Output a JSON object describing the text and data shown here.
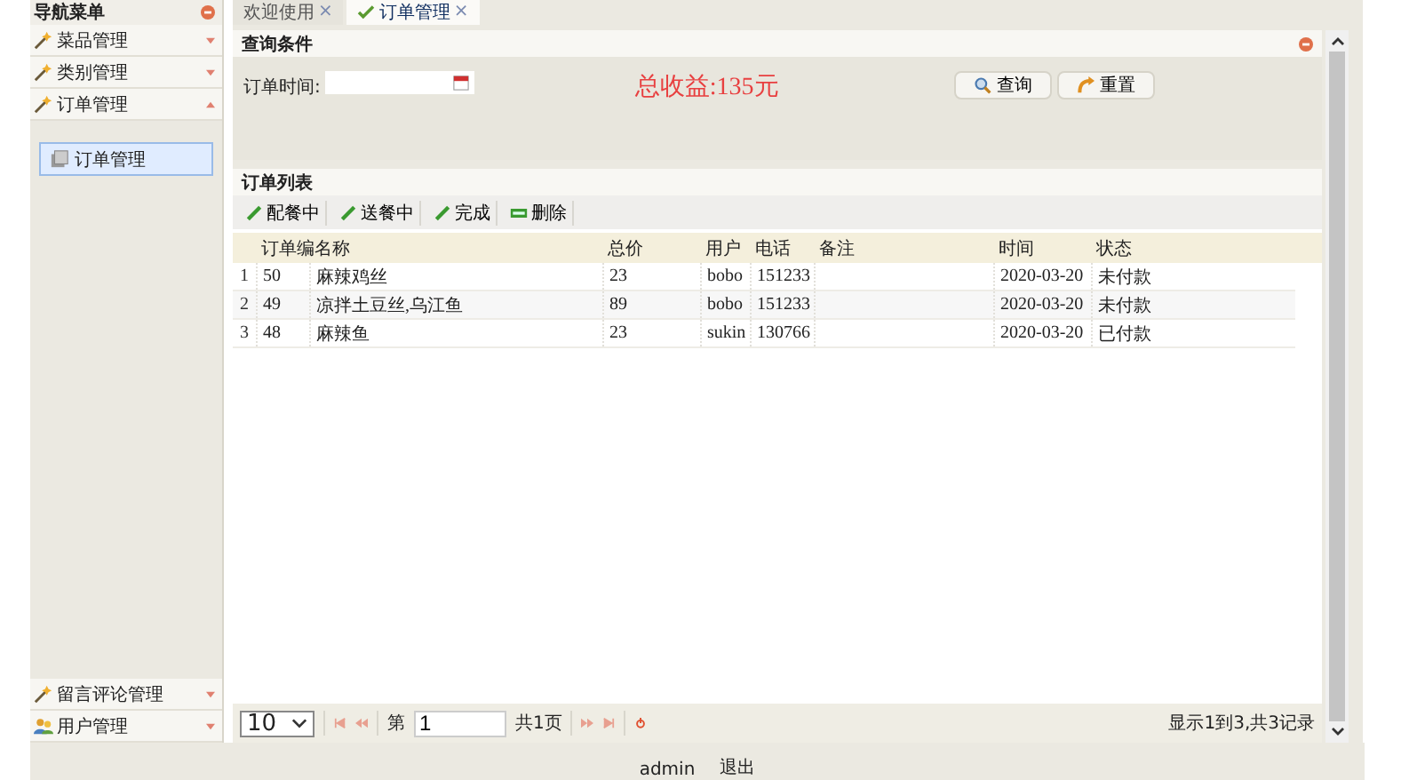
{
  "sidebar": {
    "title": "导航菜单",
    "items": [
      {
        "label": "菜品管理",
        "kind": "wand",
        "expanded": false
      },
      {
        "label": "类别管理",
        "kind": "wand",
        "expanded": false
      },
      {
        "label": "订单管理",
        "kind": "wand",
        "expanded": true,
        "children": [
          {
            "label": "订单管理",
            "selected": true
          }
        ]
      },
      {
        "label": "留言评论管理",
        "kind": "wand",
        "expanded": false
      },
      {
        "label": "用户管理",
        "kind": "users",
        "expanded": false
      }
    ]
  },
  "tabs": [
    {
      "label": "欢迎使用",
      "close": "×",
      "selected": false
    },
    {
      "label": "订单管理",
      "close": "×",
      "selected": true
    }
  ],
  "query": {
    "title": "查询条件",
    "field_label": "订单时间:",
    "total": "总收益:135元",
    "buttons": [
      {
        "label": "查询",
        "kind": "search"
      },
      {
        "label": "重置",
        "kind": "reset"
      }
    ]
  },
  "orders": {
    "title": "订单列表",
    "toolbar": [
      {
        "label": "配餐中",
        "kind": "edit"
      },
      {
        "label": "送餐中",
        "kind": "edit"
      },
      {
        "label": "完成",
        "kind": "edit"
      },
      {
        "label": "删除",
        "kind": "delete"
      }
    ],
    "columns": [
      "订单编",
      "名称",
      "总价",
      "用户",
      "电话",
      "备注",
      "时间",
      "状态"
    ],
    "rows": [
      {
        "num": "1",
        "cells": [
          "50",
          "麻辣鸡丝",
          "23",
          "bobo",
          "151233",
          "",
          "2020-03-20",
          "未付款"
        ]
      },
      {
        "num": "2",
        "cells": [
          "49",
          "凉拌土豆丝,乌江鱼",
          "89",
          "bobo",
          "151233",
          "",
          "2020-03-20",
          "未付款"
        ]
      },
      {
        "num": "3",
        "cells": [
          "48",
          "麻辣鱼",
          "23",
          "sukin",
          "130766",
          "",
          "2020-03-20",
          "已付款"
        ]
      }
    ]
  },
  "pager": {
    "page_size": "10",
    "page_prefix": "第",
    "page": "1",
    "total_pages": "共1页",
    "info": "显示1到3,共3记录"
  },
  "footer": {
    "user": "admin",
    "logout": "退出"
  }
}
